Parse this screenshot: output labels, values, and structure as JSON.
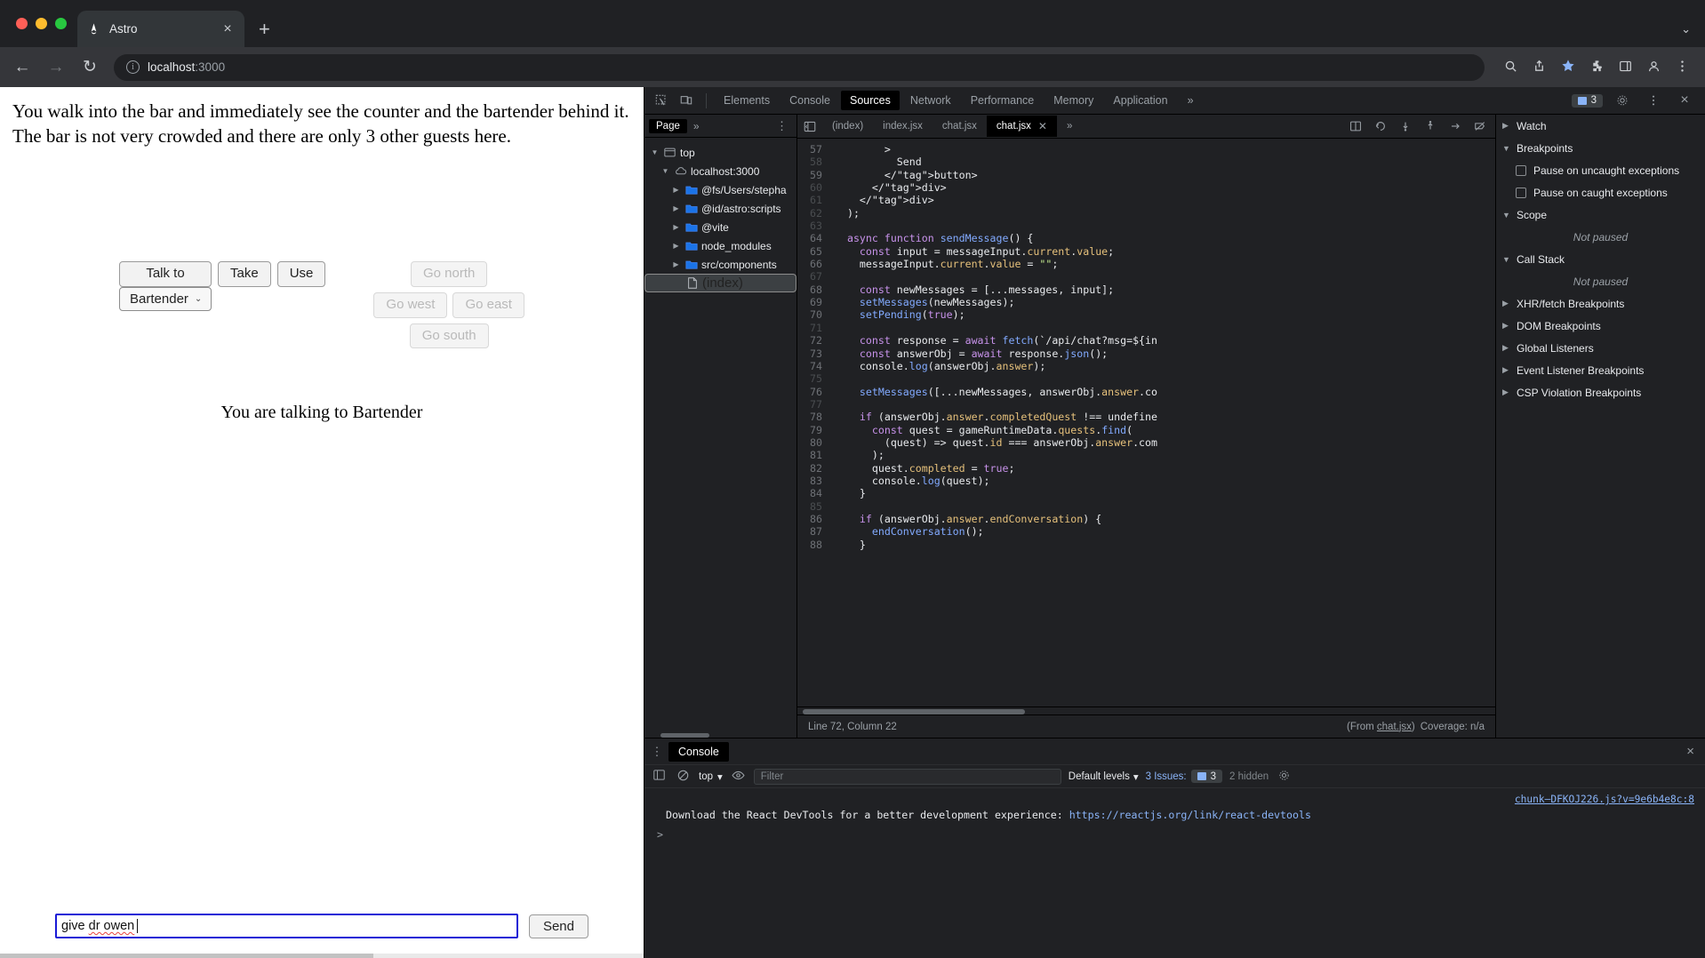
{
  "browser": {
    "tab": {
      "title": "Astro",
      "icon": "astro-logo-icon",
      "close": "×"
    },
    "newtab_label": "+",
    "tabstrip_right": "⌄",
    "nav": {
      "back": "←",
      "forward": "→",
      "reload": "↻"
    },
    "url": {
      "host": "localhost",
      "port": ":3000",
      "info_glyph": "i"
    },
    "omni_icons": [
      "search-icon",
      "share-icon",
      "bookmark-star-icon",
      "extensions-icon",
      "sidepanel-icon",
      "profile-icon",
      "menu-icon"
    ]
  },
  "page": {
    "narrative_line1": "You walk into the bar and immediately see the counter and the bartender behind it.",
    "narrative_line2": "The bar is not very crowded and there are only 3 other guests here.",
    "actions": [
      {
        "label": "Talk to",
        "disabled": false,
        "wide": true
      },
      {
        "label": "Take",
        "disabled": false,
        "wide": false
      },
      {
        "label": "Use",
        "disabled": false,
        "wide": false
      }
    ],
    "target_select": {
      "value": "Bartender",
      "chevron": "⌄"
    },
    "directions": {
      "north": {
        "label": "Go north",
        "disabled": true
      },
      "west": {
        "label": "Go west",
        "disabled": true
      },
      "east": {
        "label": "Go east",
        "disabled": true
      },
      "south": {
        "label": "Go south",
        "disabled": true
      }
    },
    "talking_to": "You are talking to Bartender",
    "composer": {
      "input_prefix": "give ",
      "input_misspelled": "dr owen",
      "send_label": "Send"
    }
  },
  "devtools": {
    "toolbar": {
      "inspect_icon": "inspect-element-icon",
      "device_icon": "device-toolbar-icon",
      "tabs": [
        {
          "label": "Elements",
          "active": false
        },
        {
          "label": "Console",
          "active": false
        },
        {
          "label": "Sources",
          "active": true
        },
        {
          "label": "Network",
          "active": false
        },
        {
          "label": "Performance",
          "active": false
        },
        {
          "label": "Memory",
          "active": false
        },
        {
          "label": "Application",
          "active": false
        }
      ],
      "overflow": "»",
      "issues_count": "3",
      "settings_icon": "gear-icon",
      "more_icon": "kebab-menu-icon",
      "close_icon": "×"
    },
    "navigator": {
      "tab_label": "Page",
      "overflow": "»",
      "more": "⋮",
      "tree": [
        {
          "label": "top",
          "depth": 0,
          "twisty": "▼",
          "glyph": "frame-icon",
          "selected": false
        },
        {
          "label": "localhost:3000",
          "depth": 1,
          "twisty": "▼",
          "glyph": "cloud-icon",
          "selected": false
        },
        {
          "label": "@fs/Users/stepha",
          "depth": 2,
          "twisty": "▶",
          "glyph": "folder-icon",
          "selected": false
        },
        {
          "label": "@id/astro:scripts",
          "depth": 2,
          "twisty": "▶",
          "glyph": "folder-icon",
          "selected": false
        },
        {
          "label": "@vite",
          "depth": 2,
          "twisty": "▶",
          "glyph": "folder-icon",
          "selected": false
        },
        {
          "label": "node_modules",
          "depth": 2,
          "twisty": "▶",
          "glyph": "folder-icon",
          "selected": false
        },
        {
          "label": "src/components",
          "depth": 2,
          "twisty": "▶",
          "glyph": "folder-icon",
          "selected": false
        },
        {
          "label": "(index)",
          "depth": 2,
          "twisty": "",
          "glyph": "file-icon",
          "selected": true
        }
      ]
    },
    "editor": {
      "panel_icon": "show-navigator-icon",
      "tabs": [
        {
          "label": "(index)",
          "active": false,
          "closable": false
        },
        {
          "label": "index.jsx",
          "active": false,
          "closable": false
        },
        {
          "label": "chat.jsx",
          "active": false,
          "closable": false
        },
        {
          "label": "chat.jsx",
          "active": true,
          "closable": true
        }
      ],
      "overflow": "»",
      "right_icons": [
        "format-icon",
        "pause-icon",
        "step-over-icon",
        "step-into-icon",
        "step-out-icon",
        "step-icon",
        "deactivate-breakpoints-icon"
      ],
      "lines": [
        {
          "n": 57,
          "dim": false,
          "text": "        >"
        },
        {
          "n": 58,
          "dim": true,
          "text": "          Send"
        },
        {
          "n": 59,
          "dim": false,
          "text": "        </button>"
        },
        {
          "n": 60,
          "dim": true,
          "text": "      </div>"
        },
        {
          "n": 61,
          "dim": true,
          "text": "    </div>"
        },
        {
          "n": 62,
          "dim": true,
          "text": "  );"
        },
        {
          "n": 63,
          "dim": true,
          "text": ""
        },
        {
          "n": 64,
          "dim": false,
          "text": "  async function sendMessage() {"
        },
        {
          "n": 65,
          "dim": false,
          "text": "    const input = messageInput.current.value;"
        },
        {
          "n": 66,
          "dim": false,
          "text": "    messageInput.current.value = \"\";"
        },
        {
          "n": 67,
          "dim": true,
          "text": ""
        },
        {
          "n": 68,
          "dim": false,
          "text": "    const newMessages = [...messages, input];"
        },
        {
          "n": 69,
          "dim": false,
          "text": "    setMessages(newMessages);"
        },
        {
          "n": 70,
          "dim": false,
          "text": "    setPending(true);"
        },
        {
          "n": 71,
          "dim": true,
          "text": ""
        },
        {
          "n": 72,
          "dim": false,
          "text": "    const response = await fetch(`/api/chat?msg=${in"
        },
        {
          "n": 73,
          "dim": false,
          "text": "    const answerObj = await response.json();"
        },
        {
          "n": 74,
          "dim": false,
          "text": "    console.log(answerObj.answer);"
        },
        {
          "n": 75,
          "dim": true,
          "text": ""
        },
        {
          "n": 76,
          "dim": false,
          "text": "    setMessages([...newMessages, answerObj.answer.co"
        },
        {
          "n": 77,
          "dim": true,
          "text": ""
        },
        {
          "n": 78,
          "dim": false,
          "text": "    if (answerObj.answer.completedQuest !== undefine"
        },
        {
          "n": 79,
          "dim": false,
          "text": "      const quest = gameRuntimeData.quests.find("
        },
        {
          "n": 80,
          "dim": false,
          "text": "        (quest) => quest.id === answerObj.answer.com"
        },
        {
          "n": 81,
          "dim": false,
          "text": "      );"
        },
        {
          "n": 82,
          "dim": false,
          "text": "      quest.completed = true;"
        },
        {
          "n": 83,
          "dim": false,
          "text": "      console.log(quest);"
        },
        {
          "n": 84,
          "dim": false,
          "text": "    }"
        },
        {
          "n": 85,
          "dim": true,
          "text": ""
        },
        {
          "n": 86,
          "dim": false,
          "text": "    if (answerObj.answer.endConversation) {"
        },
        {
          "n": 87,
          "dim": false,
          "text": "      endConversation();"
        },
        {
          "n": 88,
          "dim": false,
          "text": "    }"
        }
      ],
      "status_position": "Line 72, Column 22",
      "status_from_prefix": "(From ",
      "status_from_file": "chat.jsx",
      "status_from_suffix": ")",
      "status_coverage": "Coverage: n/a"
    },
    "sidebar": {
      "sections": [
        {
          "label": "Watch",
          "arrow": "▶",
          "type": "section"
        },
        {
          "label": "Breakpoints",
          "arrow": "▼",
          "type": "section"
        },
        {
          "label": "Pause on uncaught exceptions",
          "type": "checkbox"
        },
        {
          "label": "Pause on caught exceptions",
          "type": "checkbox"
        },
        {
          "label": "Scope",
          "arrow": "▼",
          "type": "section"
        },
        {
          "label": "Not paused",
          "type": "empty"
        },
        {
          "label": "Call Stack",
          "arrow": "▼",
          "type": "section"
        },
        {
          "label": "Not paused",
          "type": "empty"
        },
        {
          "label": "XHR/fetch Breakpoints",
          "arrow": "▶",
          "type": "section"
        },
        {
          "label": "DOM Breakpoints",
          "arrow": "▶",
          "type": "section"
        },
        {
          "label": "Global Listeners",
          "arrow": "▶",
          "type": "section"
        },
        {
          "label": "Event Listener Breakpoints",
          "arrow": "▶",
          "type": "section"
        },
        {
          "label": "CSP Violation Breakpoints",
          "arrow": "▶",
          "type": "section"
        }
      ]
    },
    "drawer": {
      "more": "⋮",
      "tab_label": "Console",
      "close": "×",
      "sidebar_icon": "console-sidebar-icon",
      "clear_icon": "clear-console-icon",
      "context": "top",
      "context_chevron": "▾",
      "eye_icon": "live-expression-icon",
      "filter_placeholder": "Filter",
      "levels_label": "Default levels",
      "levels_chevron": "▾",
      "issues_label": "3 Issues:",
      "issues_count": "3",
      "hidden_label": "2 hidden",
      "settings_icon": "console-settings-icon",
      "source_link": "chunk–DFKOJ226.js?v=9e6b4e8c:8",
      "message_text": "Download the React DevTools for a better development experience: ",
      "message_link": "https://reactjs.org/link/react-devtools",
      "prompt": ">"
    }
  }
}
